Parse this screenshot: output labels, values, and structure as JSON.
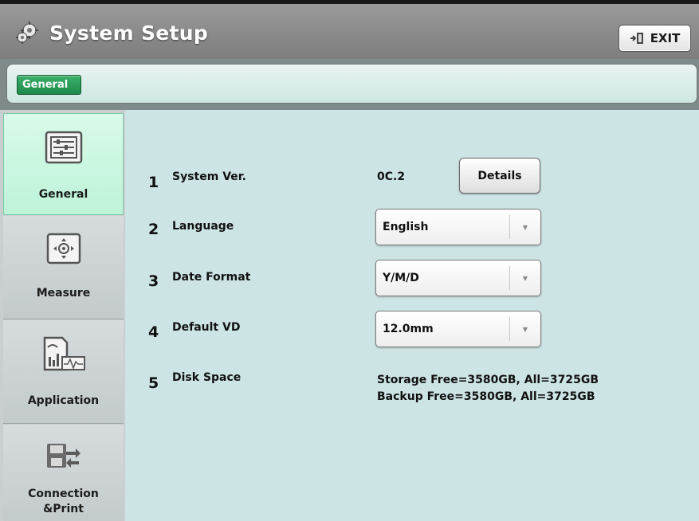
{
  "header": {
    "title": "System Setup",
    "exit_label": "EXIT"
  },
  "tabs": [
    {
      "label": "General",
      "active": true
    }
  ],
  "sidebar": {
    "items": [
      {
        "label": "General",
        "icon": "sliders-icon",
        "active": true
      },
      {
        "label": "Measure",
        "icon": "crosshair-icon",
        "active": false
      },
      {
        "label": "Application",
        "icon": "chart-waveform-icon",
        "active": false
      },
      {
        "label_line1": "Connection",
        "label_line2": "&Print",
        "icon": "save-transfer-icon",
        "active": false
      }
    ]
  },
  "settings": {
    "system_ver": {
      "num": "1",
      "label": "System Ver.",
      "value": "0C.2",
      "button": "Details"
    },
    "language": {
      "num": "2",
      "label": "Language",
      "value": "English"
    },
    "date_format": {
      "num": "3",
      "label": "Date Format",
      "value": "Y/M/D"
    },
    "default_vd": {
      "num": "4",
      "label": "Default VD",
      "value": "12.0mm"
    },
    "disk_space": {
      "num": "5",
      "label": "Disk Space",
      "storage": "Storage Free=3580GB, All=3725GB",
      "backup": "Backup Free=3580GB, All=3725GB"
    }
  },
  "colors": {
    "active_tab": "#1f8a4b",
    "active_sidebar": "#c8f7de",
    "content_bg": "#cde4e4"
  }
}
